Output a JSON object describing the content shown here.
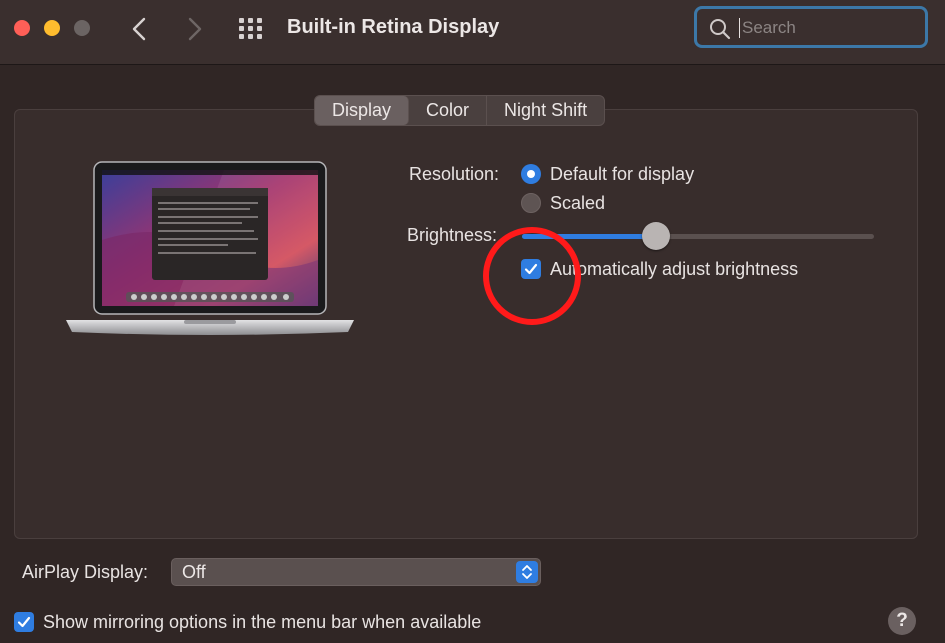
{
  "window": {
    "title": "Built-in Retina Display"
  },
  "search": {
    "placeholder": "Search",
    "value": ""
  },
  "tabs": [
    {
      "label": "Display",
      "active": true
    },
    {
      "label": "Color",
      "active": false
    },
    {
      "label": "Night Shift",
      "active": false
    }
  ],
  "resolution": {
    "label": "Resolution:",
    "options": [
      {
        "label": "Default for display",
        "selected": true
      },
      {
        "label": "Scaled",
        "selected": false
      }
    ]
  },
  "brightness": {
    "label": "Brightness:",
    "level": 0.38,
    "auto_label": "Automatically adjust brightness",
    "auto_checked": true
  },
  "airplay": {
    "label": "AirPlay Display:",
    "value": "Off"
  },
  "mirroring": {
    "label": "Show mirroring options in the menu bar when available",
    "checked": true
  },
  "help": {
    "label": "?"
  },
  "colors": {
    "accent": "#2f7de1",
    "annotation": "#ff1a1a",
    "close": "#fe5f57",
    "minimize": "#febc2e"
  },
  "icons": [
    "chevron-left-icon",
    "chevron-right-icon",
    "grid-icon",
    "search-icon",
    "checkmark-icon",
    "updown-chevron-icon",
    "laptop-illustration"
  ]
}
